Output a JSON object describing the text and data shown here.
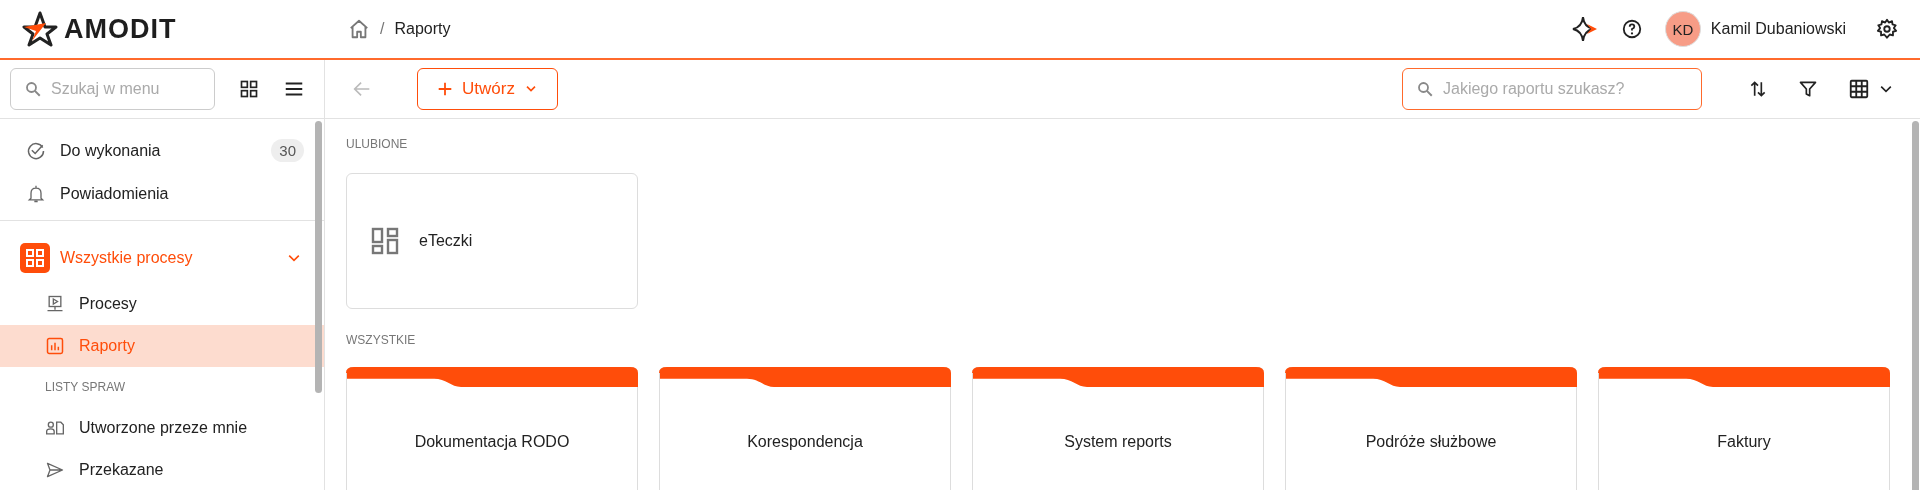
{
  "header": {
    "logo": "AMODIT",
    "breadcrumb_separator": "/",
    "breadcrumb": [
      "Raporty"
    ],
    "user": {
      "initials": "KD",
      "name": "Kamil Dubaniowski"
    }
  },
  "sidebar": {
    "search": {
      "placeholder": "Szukaj w menu"
    },
    "items": [
      {
        "label": "Do wykonania",
        "badge": "30",
        "kind": "tasks"
      },
      {
        "label": "Powiadomienia",
        "kind": "bell"
      }
    ],
    "group": {
      "label": "Wszystkie procesy",
      "expanded": true,
      "children": [
        {
          "label": "Procesy",
          "kind": "process",
          "selected": false
        },
        {
          "label": "Raporty",
          "kind": "report",
          "selected": true
        }
      ]
    },
    "section_label": "LISTY SPRAW",
    "lists": [
      {
        "label": "Utworzone przeze mnie",
        "kind": "created"
      },
      {
        "label": "Przekazane",
        "kind": "sent"
      }
    ]
  },
  "toolbar": {
    "back_disabled": true,
    "create_button": "Utwórz",
    "search": {
      "placeholder": "Jakiego raportu szukasz?"
    }
  },
  "favorites": {
    "title": "ULUBIONE",
    "items": [
      "eTeczki"
    ]
  },
  "all": {
    "title": "WSZYSTKIE",
    "items": [
      "Dokumentacja RODO",
      "Korespondencja",
      "System reports",
      "Podróże służbowe",
      "Faktury"
    ]
  }
}
